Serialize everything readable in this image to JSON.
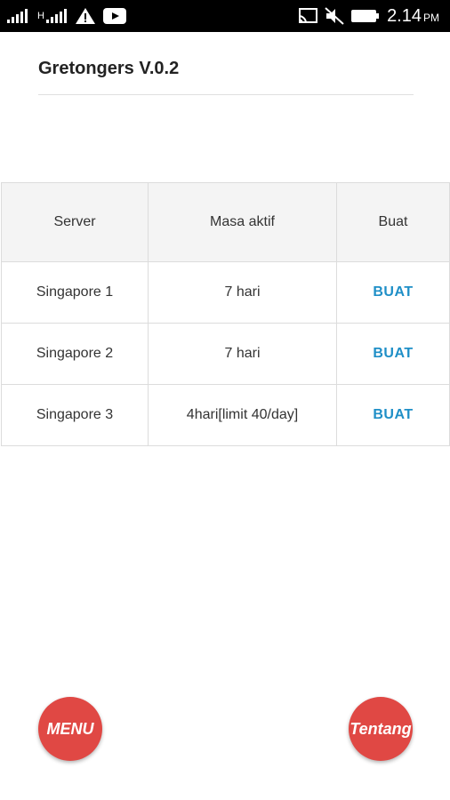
{
  "status_bar": {
    "time": "2.14",
    "ampm": "PM",
    "h_label": "H",
    "icons": [
      "signal-icon",
      "signal-h-icon",
      "warning-icon",
      "youtube-icon",
      "cast-icon",
      "mute-icon",
      "battery-icon"
    ]
  },
  "app": {
    "title": "Gretongers V.0.2"
  },
  "table": {
    "headers": [
      "Server",
      "Masa aktif",
      "Buat"
    ],
    "rows": [
      {
        "server": "Singapore 1",
        "masa_aktif": "7 hari",
        "action": "BUAT"
      },
      {
        "server": "Singapore 2",
        "masa_aktif": "7 hari",
        "action": "BUAT"
      },
      {
        "server": "Singapore 3",
        "masa_aktif": "4hari[limit 40/day]",
        "action": "BUAT"
      }
    ]
  },
  "buttons": {
    "menu": "MENU",
    "tentang": "Tentang"
  },
  "colors": {
    "accent_link": "#1f8fc7",
    "fab": "#e04844",
    "status_bar": "#000000"
  }
}
